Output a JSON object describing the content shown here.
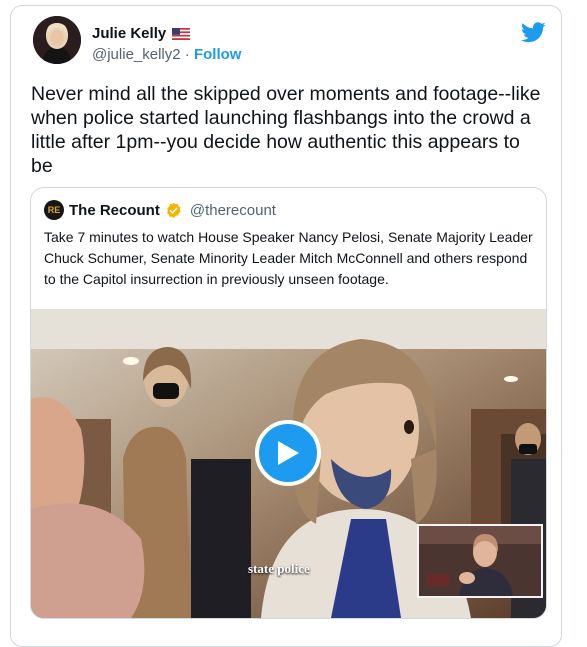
{
  "tweet": {
    "author_name": "Julie Kelly",
    "flag_icon": "us-flag-icon",
    "handle": "@julie_kelly2",
    "separator": "·",
    "follow_label": "Follow",
    "text": "Never mind all the skipped over moments and footage--like when police started launching flashbangs into the crowd a little after 1pm--you decide how authentic this appears to be",
    "brand_icon": "twitter-bird-icon",
    "brand_color": "#1d9bf0"
  },
  "quoted_tweet": {
    "logo_text": "RE",
    "author_name": "The Recount",
    "verified_icon": "verified-badge-icon",
    "verified_color": "#f5b400",
    "handle": "@therecount",
    "text": "Take 7 minutes to watch House Speaker Nancy Pelosi, Senate Majority Leader Chuck Schumer, Senate Minority Leader Mitch McConnell and others respond to the Capitol insurrection in previously unseen footage.",
    "video": {
      "caption": "state police",
      "play_icon": "play-icon"
    }
  }
}
